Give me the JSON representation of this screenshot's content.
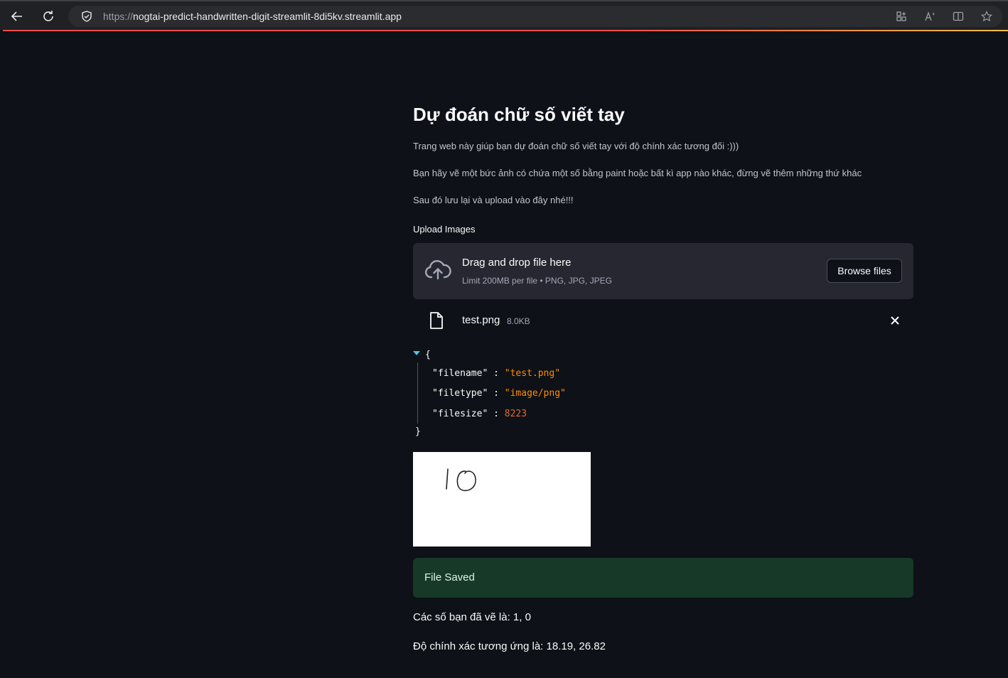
{
  "browser": {
    "url_scheme": "https://",
    "url_host": "nogtai-predict-handwritten-digit-streamlit-8di5kv.streamlit.app"
  },
  "page": {
    "title": "Dự đoán chữ số viết tay",
    "paragraphs": [
      "Trang web này giúp bạn dự đoán chữ số viết tay với độ chính xác tương đối :)))",
      "Bạn hãy vẽ một bức ảnh có chứa một số bằng paint hoặc bất kì app nào khác, đừng vẽ thêm những thứ khác",
      "Sau đó lưu lại và upload vào đây nhé!!!"
    ]
  },
  "uploader": {
    "label": "Upload Images",
    "dropzone_title": "Drag and drop file here",
    "dropzone_subtitle": "Limit 200MB per file • PNG, JPG, JPEG",
    "browse_label": "Browse files",
    "file": {
      "name": "test.png",
      "size": "8.0KB"
    }
  },
  "json_view": {
    "open_brace": "{",
    "close_brace": "}",
    "rows": [
      {
        "key": "\"filename\"",
        "value": "\"test.png\"",
        "type": "string"
      },
      {
        "key": "\"filetype\"",
        "value": "\"image/png\"",
        "type": "string"
      },
      {
        "key": "\"filesize\"",
        "value": "8223",
        "type": "number"
      }
    ]
  },
  "image_preview": {
    "digits_drawn": "10"
  },
  "status": {
    "success_message": "File Saved"
  },
  "results": {
    "digits_line": "Các số bạn đã vẽ là: 1, 0",
    "accuracy_line": "Độ chính xác tương ứng là: 18.19, 26.82"
  },
  "colors": {
    "background": "#0e1117",
    "dropzone": "#262730",
    "success_bg": "#173928",
    "json_string": "#ff8c00",
    "json_number": "#e06c2e"
  }
}
